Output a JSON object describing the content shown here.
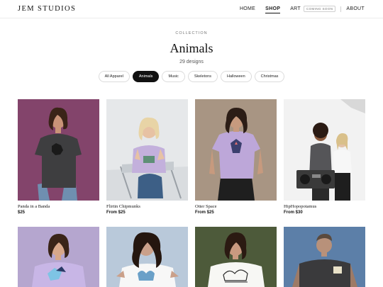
{
  "header": {
    "brand": "JEM STUDIOS",
    "nav": {
      "home": "HOME",
      "shop": "SHOP",
      "art": "ART",
      "art_badge": "COMING SOON",
      "about": "ABOUT"
    }
  },
  "collection": {
    "eyebrow": "COLLECTION",
    "title": "Animals",
    "count": "29 designs"
  },
  "filters": [
    "All Apparel",
    "Animals",
    "Music",
    "Skeletons",
    "Halloween",
    "Christmas"
  ],
  "selected_filter": "Animals",
  "products": [
    {
      "name": "Panda in a Banda",
      "price": "$25",
      "shirt": "charcoal",
      "bg": "magenta"
    },
    {
      "name": "Flirtin Chipmunks",
      "price": "From $25",
      "shirt": "lavender",
      "bg": "light-gray"
    },
    {
      "name": "Otter Space",
      "price": "From $25",
      "shirt": "lavender",
      "bg": "tan"
    },
    {
      "name": "HipHopopotamus",
      "price": "From $30",
      "shirt": "white-and-charcoal",
      "bg": "white-studio"
    },
    {
      "name": "",
      "price": "",
      "shirt": "lavender",
      "bg": "lavender"
    },
    {
      "name": "",
      "price": "",
      "shirt": "white",
      "bg": "pale-blue"
    },
    {
      "name": "",
      "price": "",
      "shirt": "white",
      "bg": "olive-green"
    },
    {
      "name": "",
      "price": "",
      "shirt": "charcoal",
      "bg": "steel-blue"
    }
  ],
  "colors": {
    "accent": "#111111",
    "chip_border": "#dcdcdc",
    "muted_text": "#777777"
  }
}
